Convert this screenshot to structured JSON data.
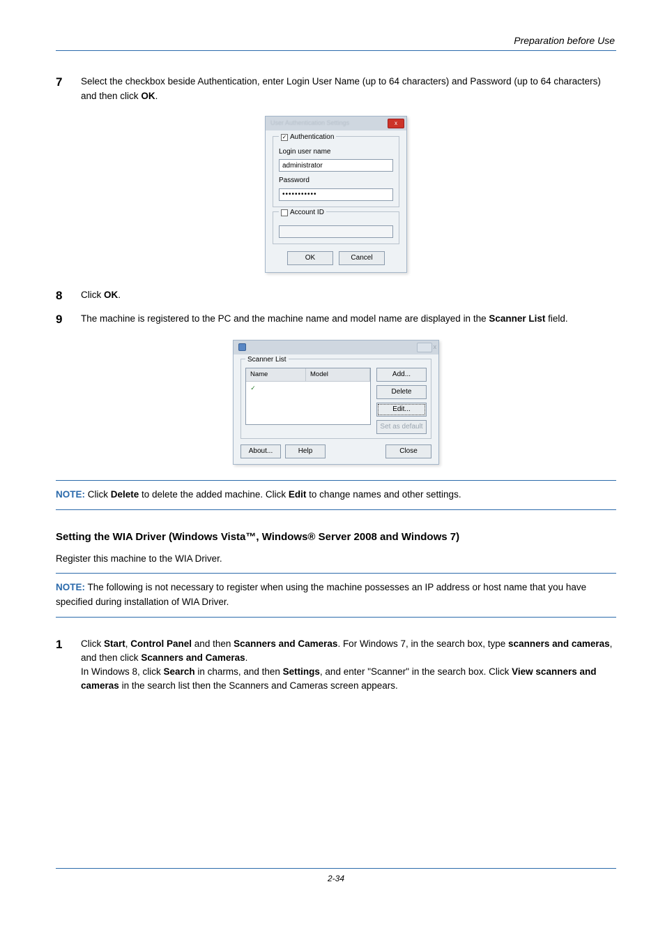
{
  "header": {
    "title": "Preparation before Use"
  },
  "step7": {
    "num": "7",
    "text_1": "Select the checkbox beside Authentication, enter Login User Name (up to 64 characters) and Password (up to 64 characters) and then click ",
    "ok": "OK",
    "text_2": "."
  },
  "dlg_auth": {
    "title": "User Authentication Settings",
    "close": "x",
    "auth_legend": "Authentication",
    "checked": "✓",
    "login_label": "Login user name",
    "login_value": "administrator",
    "pass_label": "Password",
    "pass_value": "•••••••••••",
    "account_legend": "Account ID",
    "ok": "OK",
    "cancel": "Cancel"
  },
  "step8": {
    "num": "8",
    "text_1": "Click ",
    "ok": "OK",
    "text_2": "."
  },
  "step9": {
    "num": "9",
    "text_1": "The machine is registered to the PC and the machine name and model name are displayed in the ",
    "bold": "Scanner List",
    "text_2": " field."
  },
  "dlg_list": {
    "title": "",
    "close": "x",
    "group": "Scanner List",
    "col1": "Name",
    "col2": "Model",
    "tick": "✓",
    "row_c1": "",
    "row_c2": "",
    "add": "Add...",
    "del": "Delete",
    "edit": "Edit...",
    "setdef": "Set as default",
    "about": "About...",
    "help": "Help",
    "closebtn": "Close"
  },
  "note1": {
    "label": "NOTE:",
    "t1": " Click ",
    "b1": "Delete",
    "t2": " to delete the added machine. Click ",
    "b2": "Edit",
    "t3": " to change names and other settings."
  },
  "subhead": "Setting the WIA Driver (Windows Vista™, Windows® Server 2008 and Windows 7)",
  "regline": "Register this machine to the WIA Driver.",
  "note2": {
    "label": "NOTE:",
    "text": " The following is not necessary to register when using the machine possesses an IP address or host name that you have specified during installation of WIA Driver."
  },
  "step1": {
    "num": "1",
    "p1_t1": "Click ",
    "p1_b1": "Start",
    "p1_t2": ", ",
    "p1_b2": "Control Panel",
    "p1_t3": " and then ",
    "p1_b3": "Scanners and Cameras",
    "p1_t4": ". For Windows 7, in the search box, type ",
    "p1_b4": "scanners and cameras",
    "p1_t5": ", and then click ",
    "p1_b5": "Scanners and Cameras",
    "p1_t6": ".",
    "p2_t1": "In Windows 8, click ",
    "p2_b1": "Search",
    "p2_t2": " in charms, and then ",
    "p2_b2": "Settings",
    "p2_t3": ", and enter \"Scanner\" in the search box. Click ",
    "p2_b3": "View scanners and cameras",
    "p2_t4": " in the search list then the Scanners and Cameras screen appears."
  },
  "footer": {
    "pagenum": "2-34"
  }
}
